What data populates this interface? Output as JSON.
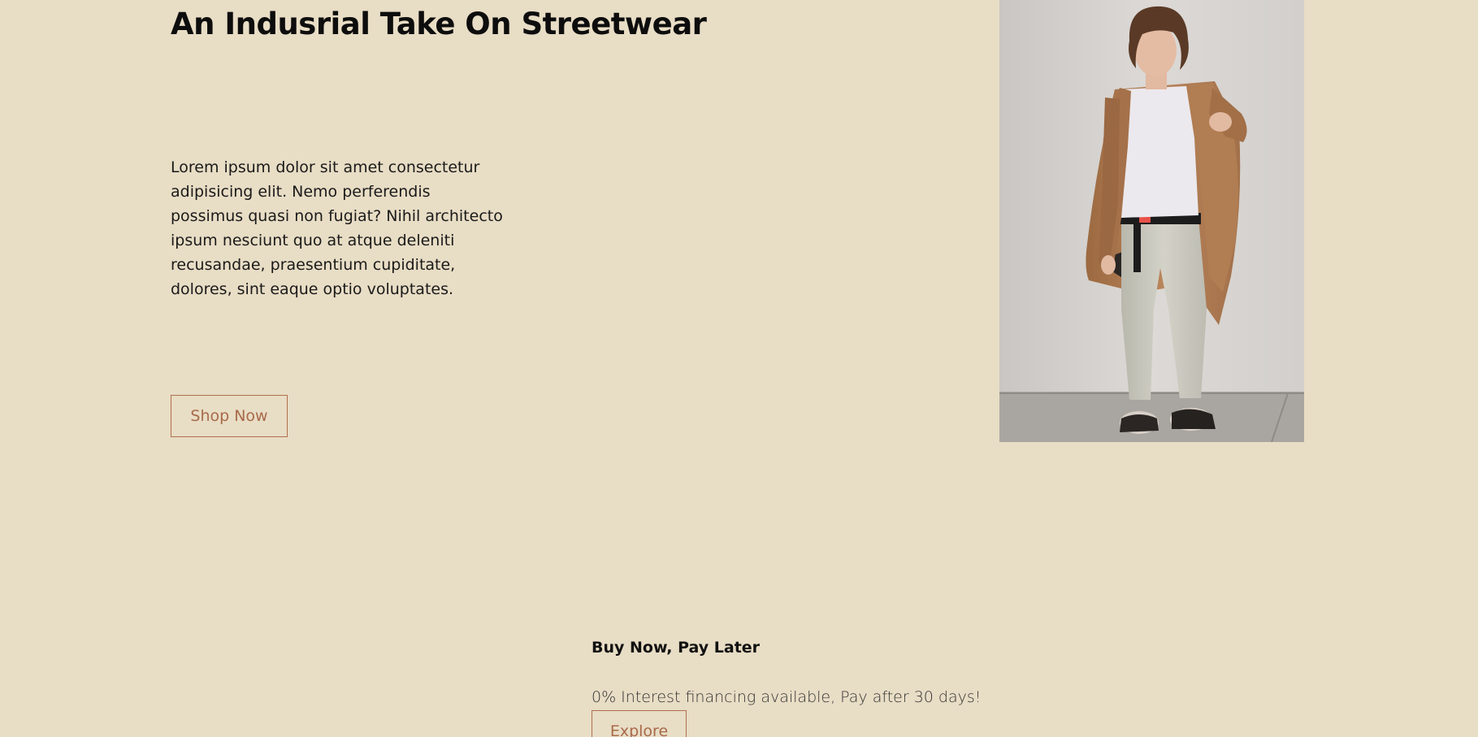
{
  "hero": {
    "title": "An Indusrial Take On Streetwear",
    "body": "Lorem ipsum dolor sit amet consectetur adipisicing elit. Nemo perferendis possimus quasi non fugiat? Nihil architecto ipsum nesciunt quo at atque deleniti recusandae, praesentium cupiditate, dolores, sint eaque optio voluptates.",
    "cta_label": "Shop Now"
  },
  "promo": {
    "title": "Buy Now, Pay Later",
    "text": "0% Interest financing available, Pay after 30 days!",
    "cta_label": "Explore"
  },
  "colors": {
    "background": "#e8ddc5",
    "accent": "#a86a4a",
    "coat": "#b07a4e",
    "wall": "#d8d5d2"
  }
}
